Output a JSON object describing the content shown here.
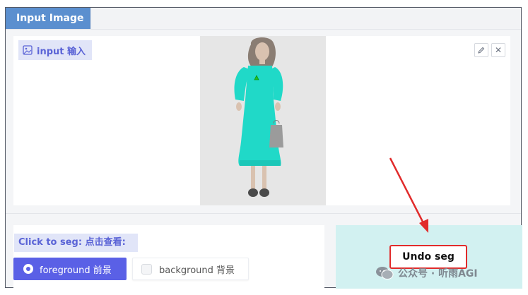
{
  "tab": {
    "label": "Input Image"
  },
  "image_panel": {
    "label": "input 输入"
  },
  "tools": {
    "edit_icon": "pencil-icon",
    "close_glyph": "✕"
  },
  "controls": {
    "seg_label": "Click to seg: 点击查看:",
    "options": [
      {
        "label": "foreground 前景",
        "selected": true
      },
      {
        "label": "background 背景",
        "selected": false
      }
    ]
  },
  "undo": {
    "label": "Undo seg"
  },
  "watermark": {
    "text": "公众号 · 听雨AGI"
  },
  "colors": {
    "tab_bg": "#5b8fcf",
    "accent": "#5a60e6",
    "mask": "#20d9c8",
    "undo_bg": "#d2f1f1",
    "highlight": "#e12b2b"
  }
}
